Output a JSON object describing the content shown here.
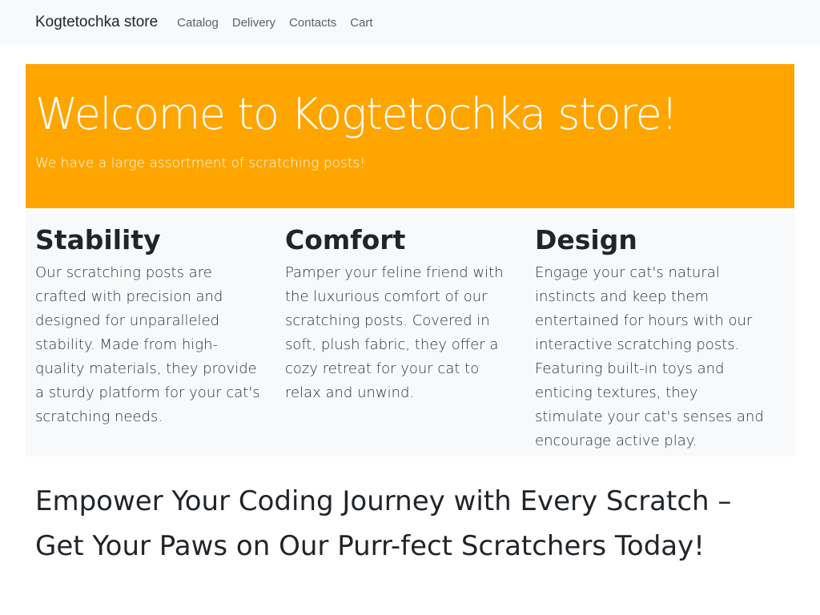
{
  "navbar": {
    "brand": "Kogtetochka store",
    "links": [
      "Catalog",
      "Delivery",
      "Contacts",
      "Cart"
    ]
  },
  "hero": {
    "title": "Welcome to Kogtetochka store!",
    "subtitle": "We have a large assortment of scratching posts!",
    "background": "#ffa500"
  },
  "features": [
    {
      "title": "Stability",
      "text": "Our scratching posts are crafted with precision and designed for unparalleled stability. Made from high-quality materials, they provide a sturdy platform for your cat's scratching needs."
    },
    {
      "title": "Comfort",
      "text": "Pamper your feline friend with the luxurious comfort of our scratching posts. Covered in soft, plush fabric, they offer a cozy retreat for your cat to relax and unwind."
    },
    {
      "title": "Design",
      "text": "Engage your cat's natural instincts and keep them entertained for hours with our interactive scratching posts. Featuring built-in toys and enticing textures, they stimulate your cat's senses and encourage active play."
    }
  ],
  "tagline": "Empower Your Coding Journey with Every Scratch – Get Your Paws on Our Purr-fect Scratchers Today!"
}
